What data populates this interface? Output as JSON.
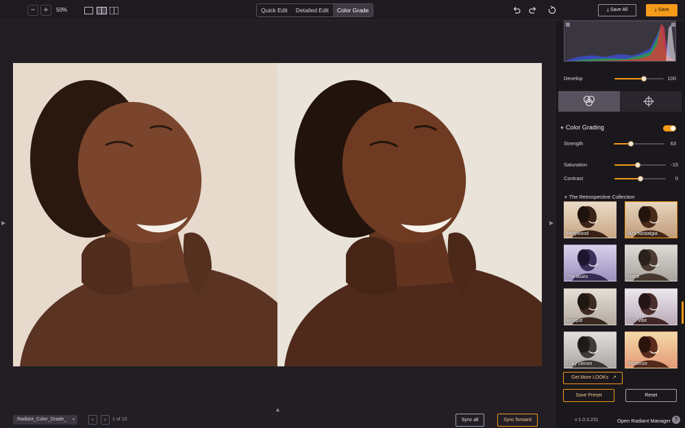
{
  "toolbar": {
    "zoom_out": "−",
    "zoom_in": "+",
    "zoom_level": "50%",
    "tabs": [
      {
        "label": "Quick Edit"
      },
      {
        "label": "Detailed Edit"
      },
      {
        "label": "Color Grade"
      }
    ],
    "active_tab": "Color Grade",
    "save_all_label": "Save All",
    "save_label": "Save"
  },
  "canvas": {
    "file_select": "Radiant_Color_Grade_",
    "page_indicator": "1 of 10",
    "sync_all_label": "Sync all",
    "sync_forward_label": "Sync forward"
  },
  "panel": {
    "develop": {
      "label": "Develop",
      "value": "100",
      "level": 0.6
    },
    "color_grading": {
      "title": "Color Grading",
      "enabled": true,
      "strength": {
        "label": "Strength",
        "value": "63",
        "level": 0.34
      },
      "saturation": {
        "label": "Saturation",
        "value": "-15",
        "level": 0.45
      },
      "contrast": {
        "label": "Contrast",
        "value": "0",
        "level": 0.5
      }
    },
    "collection_title": "The Retrospective Collection",
    "looks": [
      {
        "label": "Hollywood",
        "selected": false
      },
      {
        "label": "90's Nostalgia",
        "selected": true
      },
      {
        "label": "The Blues",
        "selected": false
      },
      {
        "label": "Matte",
        "selected": false
      },
      {
        "label": "Antique",
        "selected": false
      },
      {
        "label": "80's Vibe",
        "selected": false
      },
      {
        "label": "Gray Denim",
        "selected": false
      },
      {
        "label": "Posterize",
        "selected": false
      }
    ],
    "get_more_label": "Get More LOOKs",
    "save_preset_label": "Save Preset",
    "reset_label": "Reset",
    "version": "v:1.0.3.231",
    "manager_label": "Open Radiant Manager",
    "help_label": "?"
  },
  "colors": {
    "accent": "#f59b1a",
    "background": "#211d23",
    "panel": "#1b181d"
  }
}
